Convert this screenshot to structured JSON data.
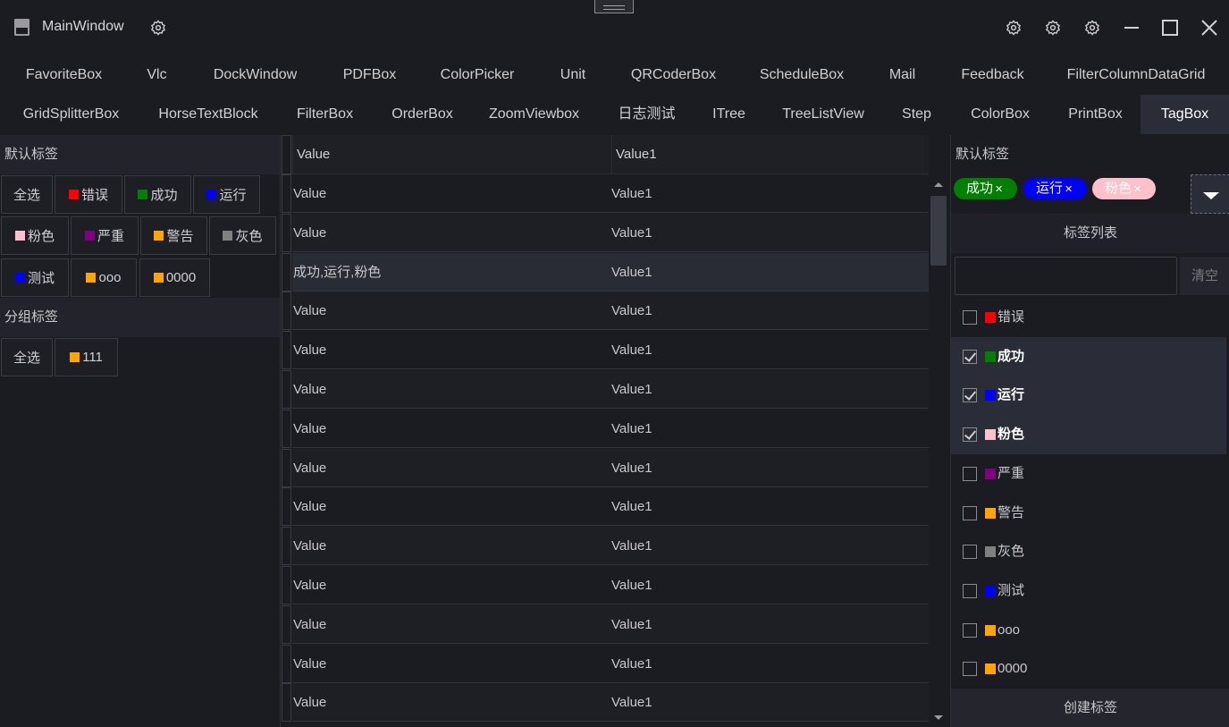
{
  "window": {
    "title": "MainWindow",
    "icons": [
      "app-icon",
      "gear-icon",
      "gear-icon",
      "gear-icon",
      "gear-icon",
      "minimize-icon",
      "maximize-icon",
      "close-icon"
    ]
  },
  "tabs_row1": [
    "FavoriteBox",
    "Vlc",
    "DockWindow",
    "PDFBox",
    "ColorPicker",
    "Unit",
    "QRCoderBox",
    "ScheduleBox",
    "Mail",
    "Feedback",
    "FilterColumnDataGrid"
  ],
  "tabs_row2": [
    "GridSplitterBox",
    "HorseTextBlock",
    "FilterBox",
    "OrderBox",
    "ZoomViewbox",
    "日志测试",
    "ITree",
    "TreeListView",
    "Step",
    "ColorBox",
    "PrintBox",
    "TagBox"
  ],
  "active_tab": "TagBox",
  "left": {
    "default_header": "默认标签",
    "default_tags": [
      {
        "label": "全选",
        "color": ""
      },
      {
        "label": "错误",
        "color": "#ff0000"
      },
      {
        "label": "成功",
        "color": "#008000"
      },
      {
        "label": "运行",
        "color": "#0000ff"
      },
      {
        "label": "粉色",
        "color": "#ffc0cb"
      },
      {
        "label": "严重",
        "color": "#800080"
      },
      {
        "label": "警告",
        "color": "#ffa500"
      },
      {
        "label": "灰色",
        "color": "#808080"
      },
      {
        "label": "测试",
        "color": "#0000ff"
      },
      {
        "label": "ooo",
        "color": "#ffa500"
      },
      {
        "label": "0000",
        "color": "#ffa500"
      }
    ],
    "group_header": "分组标签",
    "group_tags": [
      {
        "label": "全选",
        "color": ""
      },
      {
        "label": "111",
        "color": "#ffa500"
      }
    ]
  },
  "grid": {
    "columns": [
      "Value",
      "Value1"
    ],
    "rows": [
      [
        "Value",
        "Value1"
      ],
      [
        "Value",
        "Value1"
      ],
      [
        "成功,运行,粉色",
        "Value1"
      ],
      [
        "Value",
        "Value1"
      ],
      [
        "Value",
        "Value1"
      ],
      [
        "Value",
        "Value1"
      ],
      [
        "Value",
        "Value1"
      ],
      [
        "Value",
        "Value1"
      ],
      [
        "Value",
        "Value1"
      ],
      [
        "Value",
        "Value1"
      ],
      [
        "Value",
        "Value1"
      ],
      [
        "Value",
        "Value1"
      ],
      [
        "Value",
        "Value1"
      ],
      [
        "Value",
        "Value1"
      ]
    ],
    "selected_row": 2
  },
  "right": {
    "header": "默认标签",
    "chips": [
      {
        "label": "成功",
        "bg": "#008000",
        "fg": "#ffffff"
      },
      {
        "label": "运行",
        "bg": "#0000ff",
        "fg": "#ffffff"
      },
      {
        "label": "粉色",
        "bg": "#ffc0cb",
        "fg": "#ffffff"
      }
    ],
    "list_title": "标签列表",
    "search_value": "",
    "clear_label": "清空",
    "items": [
      {
        "label": "错误",
        "color": "#ff0000",
        "checked": false
      },
      {
        "label": "成功",
        "color": "#008000",
        "checked": true
      },
      {
        "label": "运行",
        "color": "#0000ff",
        "checked": true
      },
      {
        "label": "粉色",
        "color": "#ffc0cb",
        "checked": true
      },
      {
        "label": "严重",
        "color": "#800080",
        "checked": false
      },
      {
        "label": "警告",
        "color": "#ffa500",
        "checked": false
      },
      {
        "label": "灰色",
        "color": "#808080",
        "checked": false
      },
      {
        "label": "测试",
        "color": "#0000ff",
        "checked": false
      },
      {
        "label": "ooo",
        "color": "#ffa500",
        "checked": false
      },
      {
        "label": "0000",
        "color": "#ffa500",
        "checked": false
      }
    ],
    "create_label": "创建标签"
  }
}
